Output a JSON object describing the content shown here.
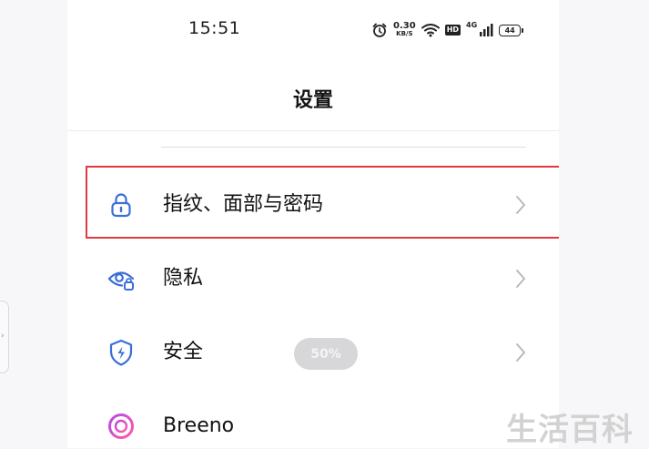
{
  "status_bar": {
    "time": "15:51",
    "net_speed_value": "0.30",
    "net_speed_unit": "KB/S",
    "hd_label": "HD",
    "network_type": "4G",
    "battery_level": "44"
  },
  "header": {
    "title": "设置"
  },
  "settings_items": [
    {
      "label": "指纹、面部与密码",
      "icon": "lock-icon"
    },
    {
      "label": "隐私",
      "icon": "privacy-eye-icon"
    },
    {
      "label": "安全",
      "icon": "shield-bolt-icon",
      "badge": "50%"
    },
    {
      "label": "Breeno",
      "icon": "breeno-ring-icon"
    }
  ],
  "colors": {
    "icon_blue": "#3a6fd8",
    "breeno_gradient_start": "#b44be8",
    "breeno_gradient_end": "#ff5aa5",
    "highlight_border": "#e0393e"
  },
  "watermark": "生活百科"
}
